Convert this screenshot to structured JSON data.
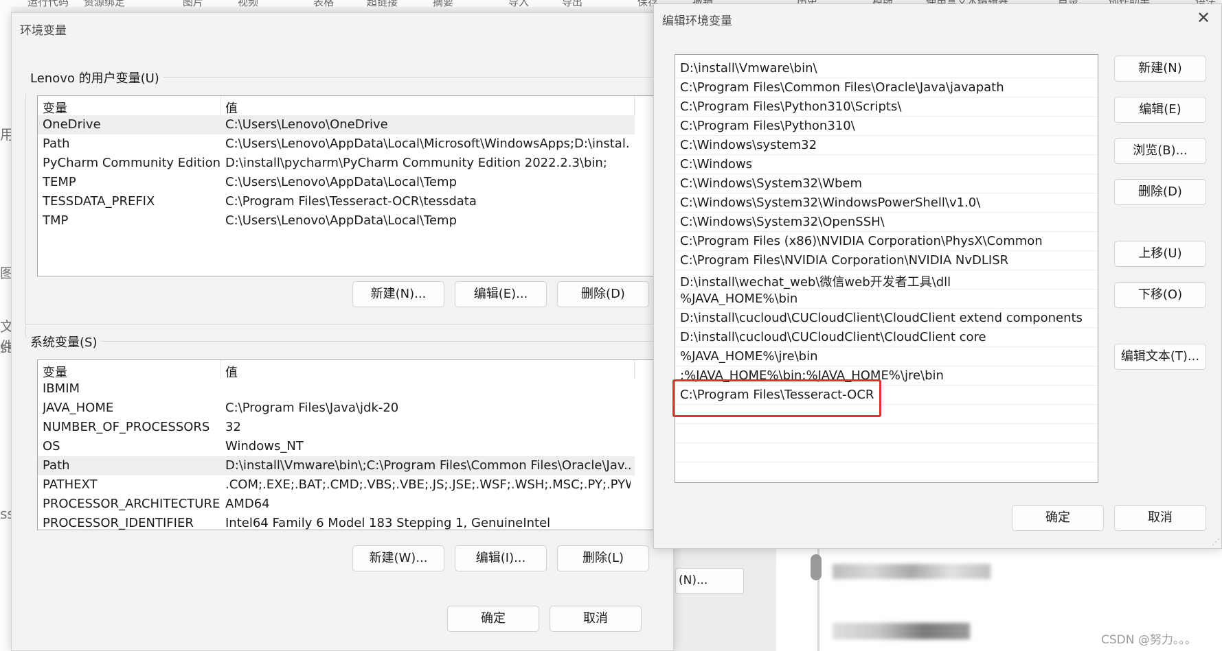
{
  "background": {
    "toolbar_items": [
      "运行代码",
      "资源绑定",
      "图片",
      "视频",
      "表格",
      "超链接",
      "摘要",
      "导入",
      "导出",
      "保存",
      "撤销",
      "历史",
      "模版",
      "使用富文本编辑器",
      "目录",
      "创作助手",
      "语法说明"
    ],
    "left_strip_glyphs": [
      "用",
      "图",
      "文件",
      "ss",
      "ss"
    ],
    "partial_button_label": "(N)...",
    "watermark": "CSDN @努力。。。"
  },
  "env_dialog": {
    "title": "环境变量",
    "user_group_label": "Lenovo 的用户变量(U)",
    "user_columns": [
      "变量",
      "值"
    ],
    "user_vars": [
      {
        "name": "OneDrive",
        "value": "C:\\Users\\Lenovo\\OneDrive"
      },
      {
        "name": "Path",
        "value": "C:\\Users\\Lenovo\\AppData\\Local\\Microsoft\\WindowsApps;D:\\instal..."
      },
      {
        "name": "PyCharm Community Edition",
        "value": "D:\\install\\pycharm\\PyCharm Community Edition 2022.2.3\\bin;"
      },
      {
        "name": "TEMP",
        "value": "C:\\Users\\Lenovo\\AppData\\Local\\Temp"
      },
      {
        "name": "TESSDATA_PREFIX",
        "value": "C:\\Program Files\\Tesseract-OCR\\tessdata"
      },
      {
        "name": "TMP",
        "value": "C:\\Users\\Lenovo\\AppData\\Local\\Temp"
      }
    ],
    "user_buttons": {
      "new": "新建(N)...",
      "edit": "编辑(E)...",
      "delete": "删除(D)"
    },
    "system_group_label": "系统变量(S)",
    "system_columns": [
      "变量",
      "值"
    ],
    "system_vars": [
      {
        "name": "IBMIM",
        "value": ""
      },
      {
        "name": "JAVA_HOME",
        "value": "C:\\Program Files\\Java\\jdk-20"
      },
      {
        "name": "NUMBER_OF_PROCESSORS",
        "value": "32"
      },
      {
        "name": "OS",
        "value": "Windows_NT"
      },
      {
        "name": "Path",
        "value": "D:\\install\\Vmware\\bin\\;C:\\Program Files\\Common Files\\Oracle\\Jav..."
      },
      {
        "name": "PATHEXT",
        "value": ".COM;.EXE;.BAT;.CMD;.VBS;.VBE;.JS;.JSE;.WSF;.WSH;.MSC;.PY;.PYW"
      },
      {
        "name": "PROCESSOR_ARCHITECTURE",
        "value": "AMD64"
      },
      {
        "name": "PROCESSOR_IDENTIFIER",
        "value": "Intel64 Family 6 Model 183 Stepping 1, GenuineIntel"
      }
    ],
    "system_buttons": {
      "new": "新建(W)...",
      "edit": "编辑(I)...",
      "delete": "删除(L)"
    },
    "ok": "确定",
    "cancel": "取消"
  },
  "edit_dialog": {
    "title": "编辑环境变量",
    "paths": [
      "D:\\install\\Vmware\\bin\\",
      "C:\\Program Files\\Common Files\\Oracle\\Java\\javapath",
      "C:\\Program Files\\Python310\\Scripts\\",
      "C:\\Program Files\\Python310\\",
      "C:\\Windows\\system32",
      "C:\\Windows",
      "C:\\Windows\\System32\\Wbem",
      "C:\\Windows\\System32\\WindowsPowerShell\\v1.0\\",
      "C:\\Windows\\System32\\OpenSSH\\",
      "C:\\Program Files (x86)\\NVIDIA Corporation\\PhysX\\Common",
      "C:\\Program Files\\NVIDIA Corporation\\NVIDIA NvDLISR",
      "D:\\install\\wechat_web\\微信web开发者工具\\dll",
      "%JAVA_HOME%\\bin",
      "D:\\install\\cucloud\\CUCloudClient\\CloudClient extend components",
      "D:\\install\\cucloud\\CUCloudClient\\CloudClient core",
      "%JAVA_HOME%\\jre\\bin",
      ";%JAVA_HOME%\\bin;%JAVA_HOME%\\jre\\bin",
      "C:\\Program Files\\Tesseract-OCR"
    ],
    "buttons": {
      "new": "新建(N)",
      "edit": "编辑(E)",
      "browse": "浏览(B)...",
      "delete": "删除(D)",
      "move_up": "上移(U)",
      "move_down": "下移(O)",
      "edit_text": "编辑文本(T)..."
    },
    "ok": "确定",
    "cancel": "取消",
    "close_icon": "✕",
    "highlight_color": "#e03030"
  }
}
